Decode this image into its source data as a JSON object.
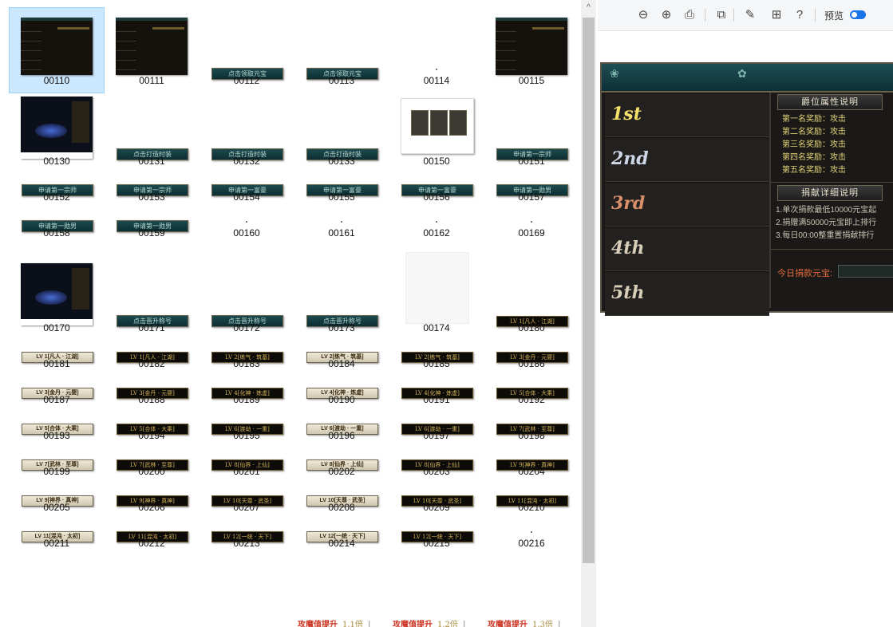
{
  "grid": {
    "items": [
      {
        "id": "00110",
        "thumb": "dark-table",
        "selected": true
      },
      {
        "id": "00111",
        "thumb": "dark-table"
      },
      {
        "id": "00112",
        "thumb": "teal-button",
        "text": "点击领取元宝"
      },
      {
        "id": "00113",
        "thumb": "teal-button",
        "text": "点击领取元宝"
      },
      {
        "id": "00114",
        "thumb": "dot"
      },
      {
        "id": "00115",
        "thumb": "dark-table"
      },
      {
        "id": "00130",
        "thumb": "scene"
      },
      {
        "id": "00131",
        "thumb": "teal-button",
        "text": "点击打造时装"
      },
      {
        "id": "00132",
        "thumb": "teal-button",
        "text": "点击打造时装"
      },
      {
        "id": "00133",
        "thumb": "teal-button",
        "text": "点击打造时装"
      },
      {
        "id": "00150",
        "thumb": "photo"
      },
      {
        "id": "00151",
        "thumb": "teal-button",
        "text": "申请第一宗师"
      },
      {
        "id": "00152",
        "thumb": "teal-button",
        "text": "申请第一宗师"
      },
      {
        "id": "00153",
        "thumb": "teal-button",
        "text": "申请第一宗师"
      },
      {
        "id": "00154",
        "thumb": "teal-button",
        "text": "申请第一富豪"
      },
      {
        "id": "00155",
        "thumb": "teal-button",
        "text": "申请第一富豪"
      },
      {
        "id": "00156",
        "thumb": "teal-button",
        "text": "申请第一富豪"
      },
      {
        "id": "00157",
        "thumb": "teal-button",
        "text": "申请第一勋男"
      },
      {
        "id": "00158",
        "thumb": "teal-button",
        "text": "申请第一勋男"
      },
      {
        "id": "00159",
        "thumb": "teal-button",
        "text": "申请第一勋男"
      },
      {
        "id": "00160",
        "thumb": "dot"
      },
      {
        "id": "00161",
        "thumb": "dot"
      },
      {
        "id": "00162",
        "thumb": "dot"
      },
      {
        "id": "00169",
        "thumb": "dot"
      },
      {
        "id": "00170",
        "thumb": "scene"
      },
      {
        "id": "00171",
        "thumb": "teal-button",
        "text": "点击晋升称号"
      },
      {
        "id": "00172",
        "thumb": "teal-button",
        "text": "点击晋升称号"
      },
      {
        "id": "00173",
        "thumb": "teal-button",
        "text": "点击晋升称号"
      },
      {
        "id": "00174",
        "thumb": "blank"
      },
      {
        "id": "00180",
        "thumb": "dark-button",
        "text": "LV 1[凡人 · 江湖]"
      },
      {
        "id": "00181",
        "thumb": "light-button",
        "text": "LV 1[凡人 · 江湖]"
      },
      {
        "id": "00182",
        "thumb": "dark-button",
        "text": "LV 1[凡人 · 江湖]"
      },
      {
        "id": "00183",
        "thumb": "dark-button",
        "text": "LV 2[练气 · 筑基]"
      },
      {
        "id": "00184",
        "thumb": "light-button",
        "text": "LV 2[练气 · 筑基]"
      },
      {
        "id": "00185",
        "thumb": "dark-button",
        "text": "LV 2[练气 · 筑基]"
      },
      {
        "id": "00186",
        "thumb": "dark-button",
        "text": "LV 3[金丹 · 元婴]"
      },
      {
        "id": "00187",
        "thumb": "light-button",
        "text": "LV 3[金丹 · 元婴]"
      },
      {
        "id": "00188",
        "thumb": "dark-button",
        "text": "LV 3[金丹 · 元婴]"
      },
      {
        "id": "00189",
        "thumb": "dark-button",
        "text": "LV 4[化神 · 炼虚]"
      },
      {
        "id": "00190",
        "thumb": "light-button",
        "text": "LV 4[化神 · 炼虚]"
      },
      {
        "id": "00191",
        "thumb": "dark-button",
        "text": "LV 4[化神 · 炼虚]"
      },
      {
        "id": "00192",
        "thumb": "dark-button",
        "text": "LV 5[合体 · 大乘]"
      },
      {
        "id": "00193",
        "thumb": "light-button",
        "text": "LV 5[合体 · 大乘]"
      },
      {
        "id": "00194",
        "thumb": "dark-button",
        "text": "LV 5[合体 · 大乘]"
      },
      {
        "id": "00195",
        "thumb": "dark-button",
        "text": "LV 6[渡劫 · 一重]"
      },
      {
        "id": "00196",
        "thumb": "light-button",
        "text": "LV 6[渡劫 · 一重]"
      },
      {
        "id": "00197",
        "thumb": "dark-button",
        "text": "LV 6[渡劫 · 一重]"
      },
      {
        "id": "00198",
        "thumb": "dark-button",
        "text": "LV 7[武林 · 至尊]"
      },
      {
        "id": "00199",
        "thumb": "light-button",
        "text": "LV 7[武林 · 至尊]"
      },
      {
        "id": "00200",
        "thumb": "dark-button",
        "text": "LV 7[武林 · 至尊]"
      },
      {
        "id": "00201",
        "thumb": "dark-button",
        "text": "LV 8[仙界 · 上仙]"
      },
      {
        "id": "00202",
        "thumb": "light-button",
        "text": "LV 8[仙界 · 上仙]"
      },
      {
        "id": "00203",
        "thumb": "dark-button",
        "text": "LV 8[仙界 · 上仙]"
      },
      {
        "id": "00204",
        "thumb": "dark-button",
        "text": "LV 9[神界 · 真神]"
      },
      {
        "id": "00205",
        "thumb": "light-button",
        "text": "LV 9[神界 · 真神]"
      },
      {
        "id": "00206",
        "thumb": "dark-button",
        "text": "LV 9[神界 · 真神]"
      },
      {
        "id": "00207",
        "thumb": "dark-button",
        "text": "LV 10[天尊 · 武圣]"
      },
      {
        "id": "00208",
        "thumb": "light-button",
        "text": "LV 10[天尊 · 武圣]"
      },
      {
        "id": "00209",
        "thumb": "dark-button",
        "text": "LV 10[天尊 · 武圣]"
      },
      {
        "id": "00210",
        "thumb": "dark-button",
        "text": "LV 11[混沌 · 太初]"
      },
      {
        "id": "00211",
        "thumb": "light-button",
        "text": "LV 11[混沌 · 太初]"
      },
      {
        "id": "00212",
        "thumb": "dark-button",
        "text": "LV 11[混沌 · 太初]"
      },
      {
        "id": "00213",
        "thumb": "dark-button",
        "text": "LV 12[一统 · 天下]"
      },
      {
        "id": "00214",
        "thumb": "light-button",
        "text": "LV 12[一统 · 天下]"
      },
      {
        "id": "00215",
        "thumb": "dark-button",
        "text": "LV 12[一统 · 天下]"
      },
      {
        "id": "00216",
        "thumb": "dot"
      }
    ],
    "bottom_row": [
      {
        "text": "攻魔值提升",
        "mult": "1.1倍"
      },
      {
        "text": "攻魔值提升",
        "mult": "1.2倍"
      },
      {
        "text": "攻魔值提升",
        "mult": "1.3倍"
      }
    ]
  },
  "scrollbar": {
    "up_icon": "chevron-up-icon",
    "up_glyph": "^"
  },
  "toolbar": {
    "tools": [
      {
        "name": "zoom-out-icon",
        "glyph": "⊖"
      },
      {
        "name": "zoom-in-icon",
        "glyph": "⊕"
      },
      {
        "name": "print-icon",
        "glyph": "⎙"
      },
      {
        "name": "open-external-icon",
        "glyph": "⧉"
      },
      {
        "name": "edit-image-icon",
        "glyph": "✎"
      },
      {
        "name": "apps-icon",
        "glyph": "⊞"
      },
      {
        "name": "help-icon",
        "glyph": "?"
      }
    ],
    "preview_label": "预览",
    "preview_toggle_on": true
  },
  "preview": {
    "ranks": [
      {
        "label": "1st",
        "color": "#f4e06a"
      },
      {
        "label": "2nd",
        "color": "#cfd6e6"
      },
      {
        "label": "3rd",
        "color": "#d9906a"
      },
      {
        "label": "4th",
        "color": "#d8cdb8"
      },
      {
        "label": "5th",
        "color": "#d8cdb8"
      }
    ],
    "section1_title": "爵位属性说明",
    "rewards": [
      "第一名奖励：攻击",
      "第二名奖励：攻击",
      "第三名奖励：攻击",
      "第四名奖励：攻击",
      "第五名奖励：攻击"
    ],
    "section2_title": "捐献详细说明",
    "rules": [
      "1.单次捐款最低10000元宝起",
      "2.捐赠满50000元宝即上排行",
      "3.每日00:00整重置捐献排行"
    ],
    "donate_label": "今日捐款元宝:",
    "accent": "#e4d278"
  }
}
